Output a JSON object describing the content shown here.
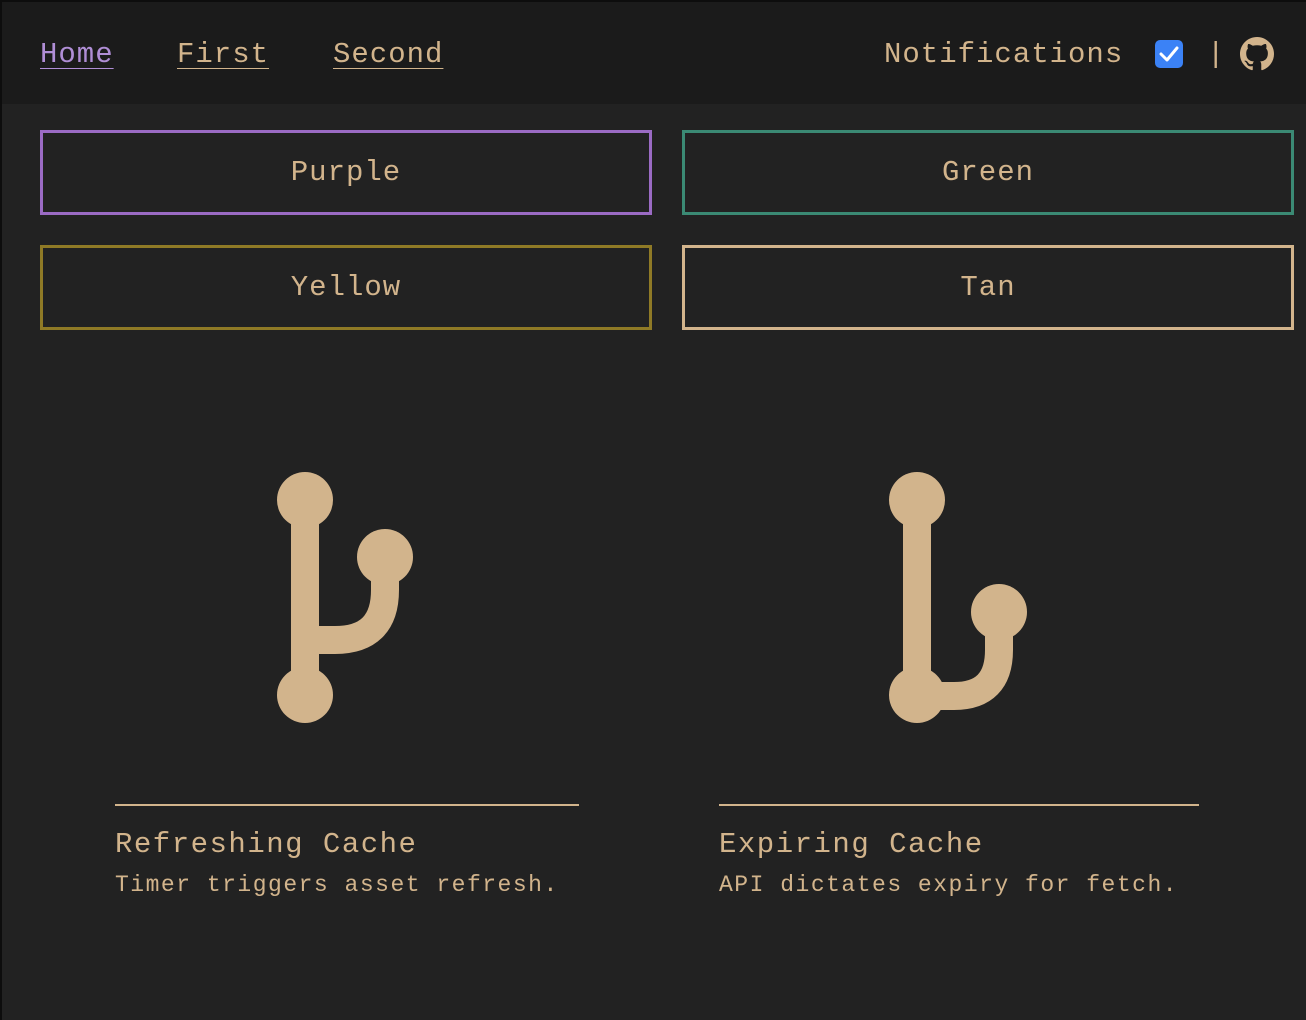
{
  "nav": {
    "links": [
      {
        "label": "Home",
        "active": true
      },
      {
        "label": "First",
        "active": false
      },
      {
        "label": "Second",
        "active": false
      }
    ],
    "notifications_label": "Notifications",
    "notifications_checked": true,
    "separator": "|",
    "github_icon": "github-icon"
  },
  "buttons": [
    {
      "label": "Purple",
      "color": "#9b6bc4"
    },
    {
      "label": "Green",
      "color": "#3b8a74"
    },
    {
      "label": "Yellow",
      "color": "#8f7a26"
    },
    {
      "label": "Tan",
      "color": "#d2b48c"
    }
  ],
  "cards": [
    {
      "icon": "git-branch-icon",
      "title": "Refreshing Cache",
      "description": "Timer triggers asset refresh."
    },
    {
      "icon": "git-merge-icon",
      "title": "Expiring Cache",
      "description": "API dictates expiry for fetch."
    }
  ],
  "colors": {
    "background": "#222222",
    "nav_background": "#1b1b1b",
    "accent": "#d2b48c",
    "active_link": "#b08ed6",
    "checkbox": "#3b82f6"
  }
}
